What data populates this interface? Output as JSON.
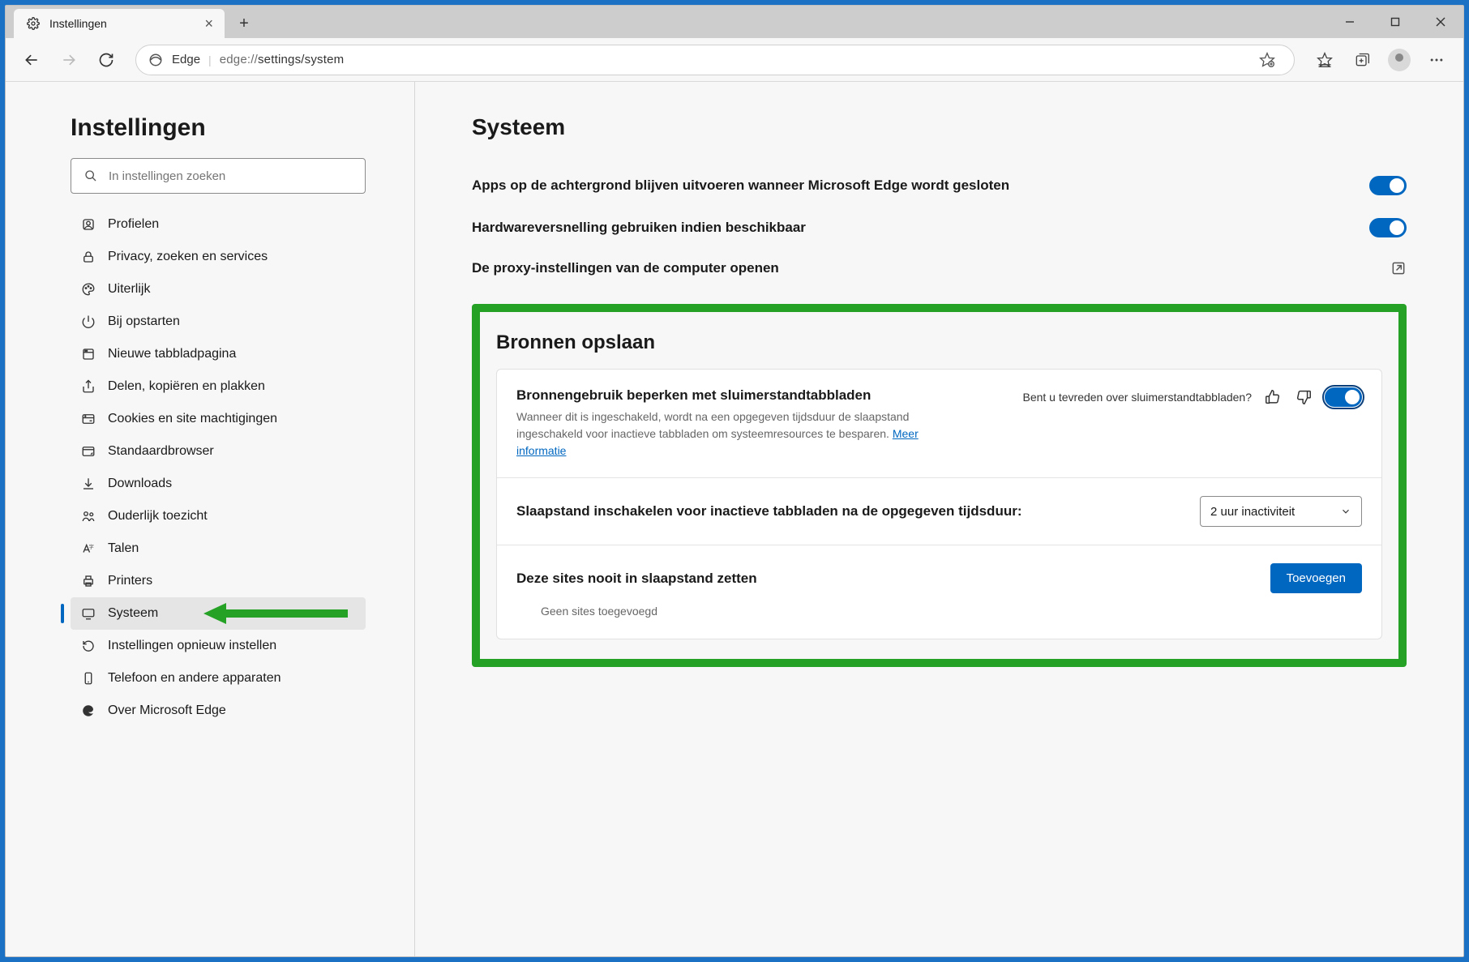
{
  "window": {
    "tab_title": "Instellingen",
    "addr_label": "Edge",
    "addr_url_prefix": "edge://",
    "addr_url_path": "settings/system"
  },
  "sidebar": {
    "heading": "Instellingen",
    "search_placeholder": "In instellingen zoeken",
    "items": [
      {
        "label": "Profielen"
      },
      {
        "label": "Privacy, zoeken en services"
      },
      {
        "label": "Uiterlijk"
      },
      {
        "label": "Bij opstarten"
      },
      {
        "label": "Nieuwe tabbladpagina"
      },
      {
        "label": "Delen, kopiëren en plakken"
      },
      {
        "label": "Cookies en site machtigingen"
      },
      {
        "label": "Standaardbrowser"
      },
      {
        "label": "Downloads"
      },
      {
        "label": "Ouderlijk toezicht"
      },
      {
        "label": "Talen"
      },
      {
        "label": "Printers"
      },
      {
        "label": "Systeem"
      },
      {
        "label": "Instellingen opnieuw instellen"
      },
      {
        "label": "Telefoon en andere apparaten"
      },
      {
        "label": "Over Microsoft Edge"
      }
    ]
  },
  "main": {
    "title": "Systeem",
    "rows": {
      "bg_apps": "Apps op de achtergrond blijven uitvoeren wanneer Microsoft Edge wordt gesloten",
      "hw_accel": "Hardwareversnelling gebruiken indien beschikbaar",
      "proxy": "De proxy-instellingen van de computer openen"
    },
    "resources": {
      "section_title": "Bronnen opslaan",
      "limit_title": "Bronnengebruik beperken met sluimerstandtabbladen",
      "limit_desc": "Wanneer dit is ingeschakeld, wordt na een opgegeven tijdsduur de slaapstand ingeschakeld voor inactieve tabbladen om systeemresources te besparen. ",
      "learn_more": "Meer informatie",
      "feedback_q": "Bent u tevreden over sluimerstandtabbladen?",
      "sleep_after_title": "Slaapstand inschakelen voor inactieve tabbladen na de opgegeven tijdsduur:",
      "sleep_after_value": "2 uur inactiviteit",
      "never_sleep_title": "Deze sites nooit in slaapstand zetten",
      "add_button": "Toevoegen",
      "empty_sites": "Geen sites toegevoegd"
    }
  }
}
